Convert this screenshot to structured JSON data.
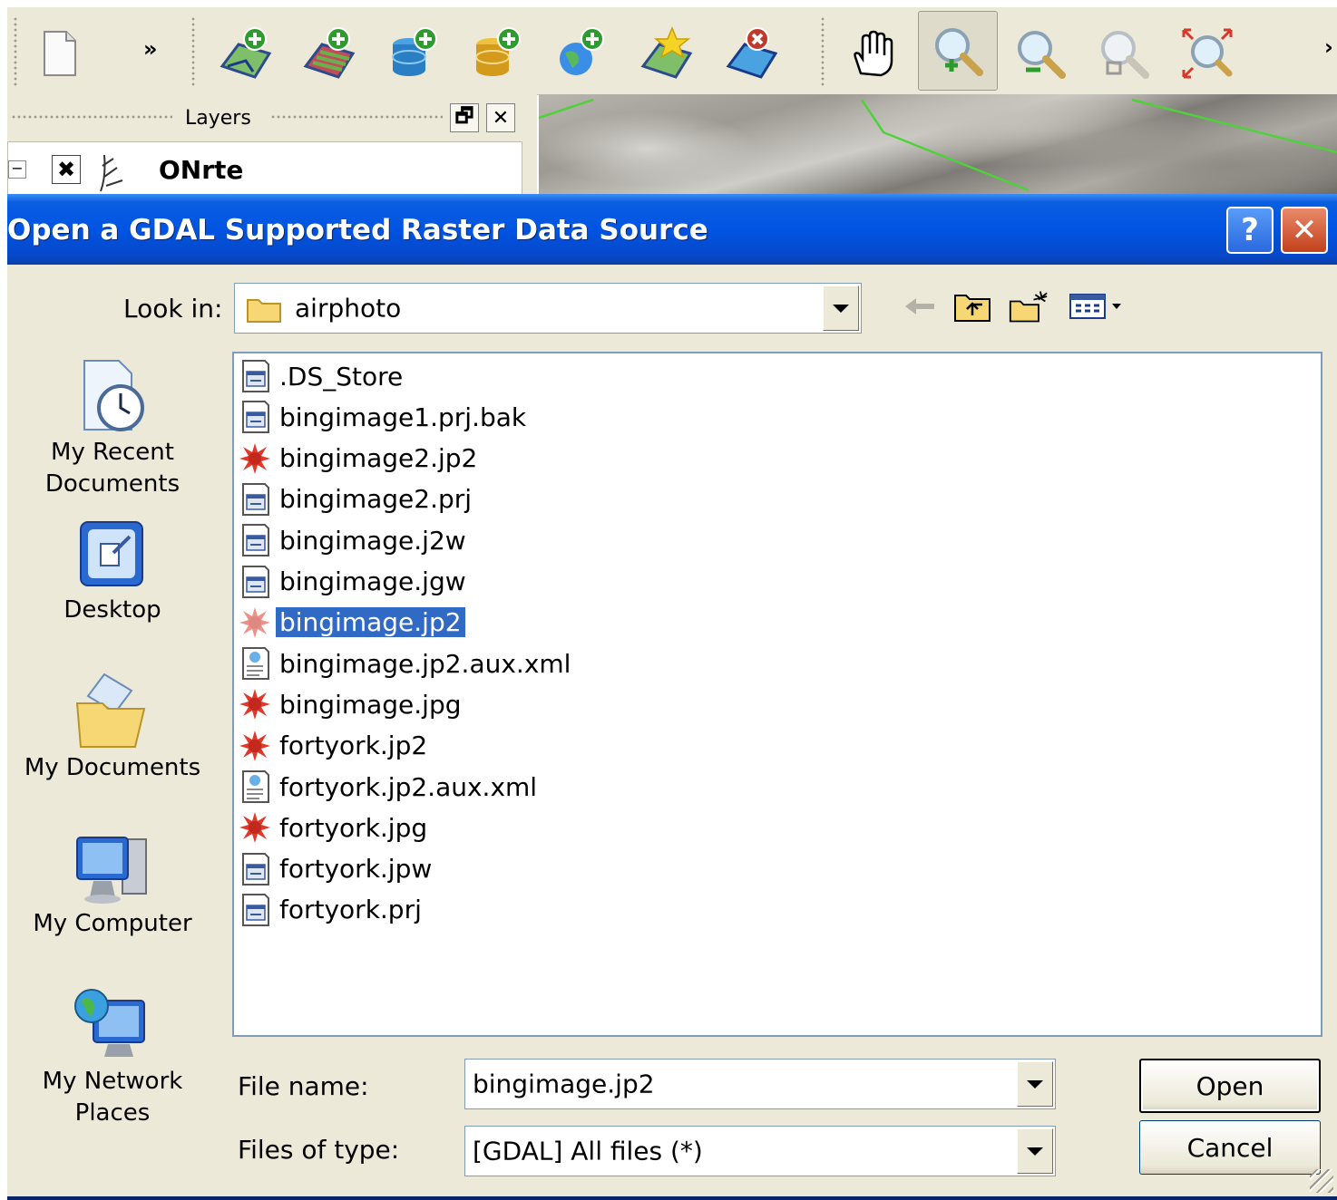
{
  "toolbar": {
    "buttons": [
      {
        "name": "new-project",
        "icon": "new-document-icon"
      },
      {
        "name": "add-vector-layer",
        "icon": "add-vector-layer-icon"
      },
      {
        "name": "add-raster-layer",
        "icon": "add-raster-layer-icon"
      },
      {
        "name": "add-postgis-layer",
        "icon": "add-postgis-layer-icon"
      },
      {
        "name": "add-spatialite-layer",
        "icon": "add-spatialite-layer-icon"
      },
      {
        "name": "add-wms-layer",
        "icon": "add-wms-layer-icon"
      },
      {
        "name": "new-shapefile-layer",
        "icon": "new-shapefile-layer-icon"
      },
      {
        "name": "remove-layer",
        "icon": "remove-layer-icon"
      },
      {
        "name": "pan-map",
        "icon": "pan-hand-icon"
      },
      {
        "name": "zoom-in",
        "icon": "zoom-in-icon",
        "pressed": true
      },
      {
        "name": "zoom-out",
        "icon": "zoom-out-icon"
      },
      {
        "name": "zoom-full",
        "icon": "zoom-full-icon"
      },
      {
        "name": "zoom-to-layer",
        "icon": "zoom-to-layer-icon"
      }
    ],
    "overflow_label": "»",
    "overflow_right_label": "›"
  },
  "layers_panel": {
    "title": "Layers",
    "float_label": "🗗",
    "close_label": "✕",
    "layer": {
      "name": "ONrte",
      "checked": true,
      "check_mark": "✖",
      "expander": "−"
    }
  },
  "dialog": {
    "title": "Open a GDAL Supported Raster Data Source",
    "help_label": "?",
    "close_label": "✕",
    "look_in": {
      "label": "Look in:",
      "value": "airphoto"
    },
    "places": [
      {
        "label": "My Recent Documents",
        "icon": "recent-documents-icon"
      },
      {
        "label": "Desktop",
        "icon": "desktop-icon"
      },
      {
        "label": "My Documents",
        "icon": "my-documents-icon"
      },
      {
        "label": "My Computer",
        "icon": "my-computer-icon"
      },
      {
        "label": "My Network Places",
        "icon": "network-places-icon"
      }
    ],
    "files": [
      {
        "name": ".DS_Store",
        "type": "generic"
      },
      {
        "name": "bingimage1.prj.bak",
        "type": "generic"
      },
      {
        "name": "bingimage2.jp2",
        "type": "raster"
      },
      {
        "name": "bingimage2.prj",
        "type": "generic"
      },
      {
        "name": "bingimage.j2w",
        "type": "generic"
      },
      {
        "name": "bingimage.jgw",
        "type": "generic"
      },
      {
        "name": "bingimage.jp2",
        "type": "raster",
        "selected": true
      },
      {
        "name": "bingimage.jp2.aux.xml",
        "type": "xml"
      },
      {
        "name": "bingimage.jpg",
        "type": "raster"
      },
      {
        "name": "fortyork.jp2",
        "type": "raster"
      },
      {
        "name": "fortyork.jp2.aux.xml",
        "type": "xml"
      },
      {
        "name": "fortyork.jpg",
        "type": "raster"
      },
      {
        "name": "fortyork.jpw",
        "type": "generic"
      },
      {
        "name": "fortyork.prj",
        "type": "generic"
      }
    ],
    "file_name": {
      "label": "File name:",
      "value": "bingimage.jp2"
    },
    "files_of_type": {
      "label": "Files of type:",
      "value": "[GDAL] All files (*)"
    },
    "open_label": "Open",
    "cancel_label": "Cancel"
  }
}
